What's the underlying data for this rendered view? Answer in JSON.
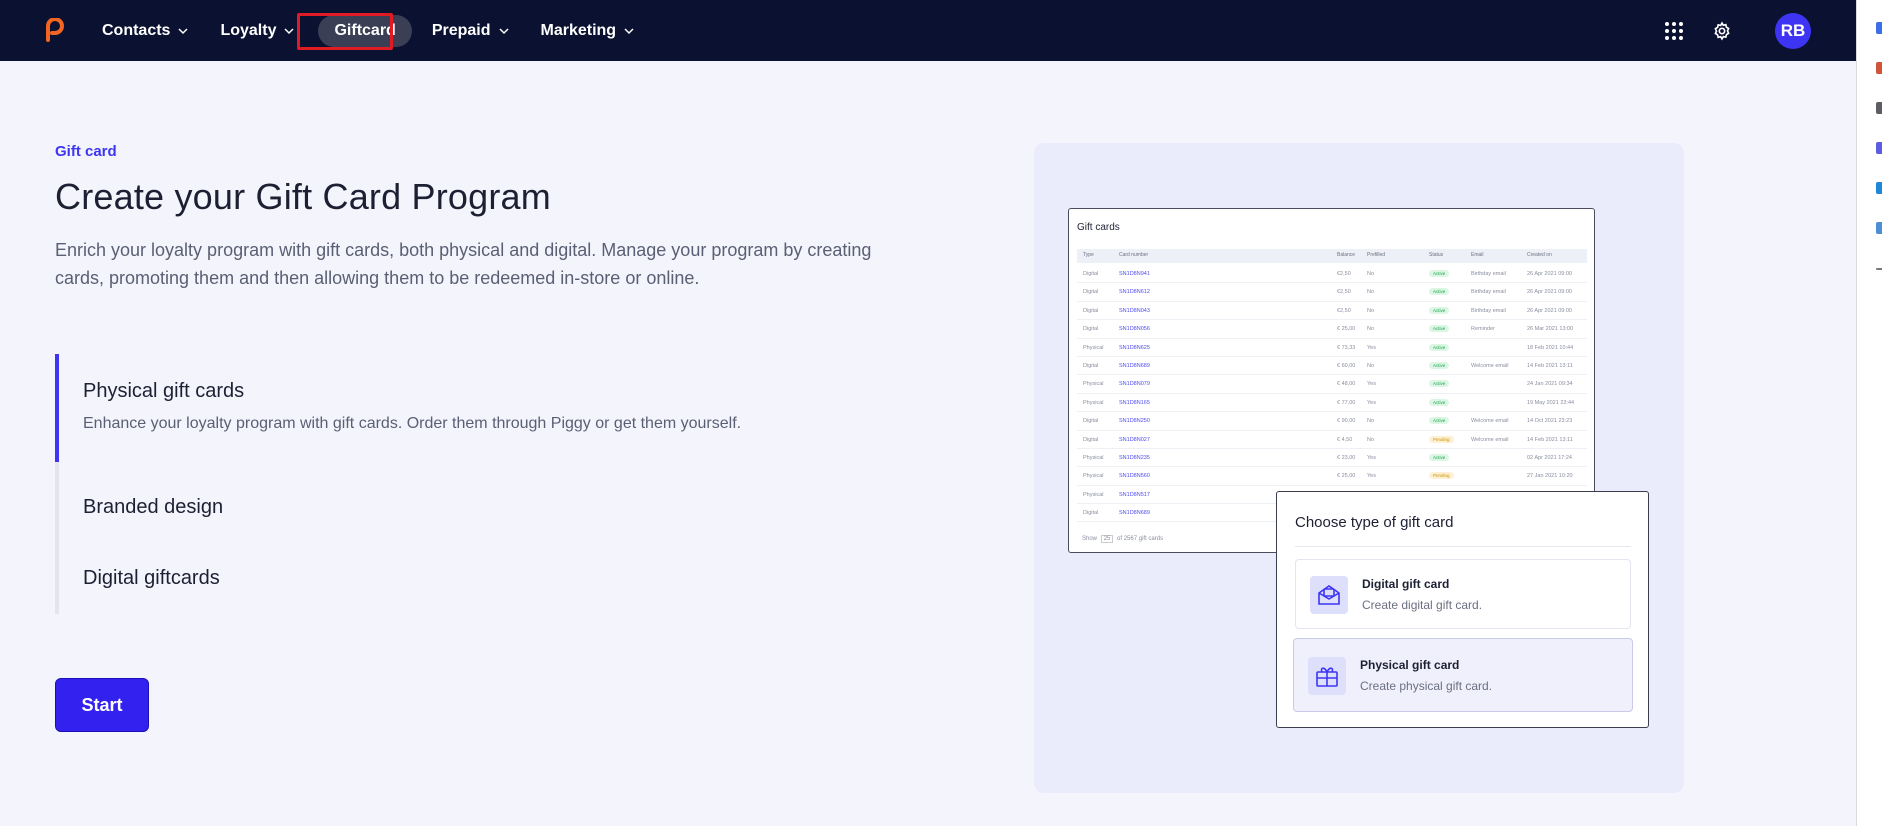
{
  "nav": {
    "items": [
      {
        "label": "Contacts",
        "has_dropdown": true
      },
      {
        "label": "Loyalty",
        "has_dropdown": true
      },
      {
        "label": "Giftcard",
        "has_dropdown": false,
        "active": true
      },
      {
        "label": "Prepaid",
        "has_dropdown": true
      },
      {
        "label": "Marketing",
        "has_dropdown": true
      }
    ],
    "logo_icon": "piggy-logo-icon",
    "apps_icon": "grid-icon",
    "settings_icon": "gear-icon",
    "avatar_initials": "RB"
  },
  "hero": {
    "eyebrow": "Gift card",
    "title": "Create your Gift Card Program",
    "subtitle": "Enrich your loyalty program with gift cards, both physical and digital. Manage your program by creating cards, promoting them and then allowing them to be redeemed in-store or online."
  },
  "features": [
    {
      "title": "Physical gift cards",
      "description": "Enhance your loyalty program with gift cards. Order them through Piggy or get them yourself.",
      "active": true
    },
    {
      "title": "Branded design",
      "active": false
    },
    {
      "title": "Digital giftcards",
      "active": false
    }
  ],
  "start_label": "Start",
  "illustration": {
    "table_title": "Gift cards",
    "columns": [
      "Type",
      "Card number",
      "Balance",
      "Prefilled",
      "Status",
      "Email",
      "Created on"
    ],
    "rows": [
      [
        "Digital",
        "SN1D8N941",
        "€2,50",
        "No",
        "Active",
        "Birthday email",
        "26 Apr 2021 09:00"
      ],
      [
        "Digital",
        "SN1D8N612",
        "€2,50",
        "No",
        "Active",
        "Birthday email",
        "26 Apr 2021 09:00"
      ],
      [
        "Digital",
        "SN1D8N043",
        "€2,50",
        "No",
        "Active",
        "Birthday email",
        "26 Apr 2021 09:00"
      ],
      [
        "Digital",
        "SN1D8N056",
        "€ 25,00",
        "No",
        "Active",
        "Reminder",
        "26 Mar 2021 13:00"
      ],
      [
        "Physical",
        "SN1D8N625",
        "€ 73,33",
        "Yes",
        "Active",
        "",
        "18 Feb 2021 10:44"
      ],
      [
        "Digital",
        "SN1D8N689",
        "€ 60,00",
        "No",
        "Active",
        "Welcome email",
        "14 Feb 2021 13:11"
      ],
      [
        "Physical",
        "SN1D8N079",
        "€ 48,00",
        "Yes",
        "Active",
        "",
        "24 Jan 2021 09:34"
      ],
      [
        "Physical",
        "SN1D8N165",
        "€ 77,00",
        "Yes",
        "Active",
        "",
        "19 May 2021 23:44"
      ],
      [
        "Digital",
        "SN1D8N250",
        "€ 90,00",
        "No",
        "Active",
        "Welcome email",
        "14 Oct 2021 23:23"
      ],
      [
        "Digital",
        "SN1D8N027",
        "€ 4,50",
        "No",
        "Pending",
        "Welcome email",
        "14 Feb 2021 13:11"
      ],
      [
        "Physical",
        "SN1D8N235",
        "€ 23,00",
        "Yes",
        "Active",
        "",
        "02 Apr 2021 17:24"
      ],
      [
        "Physical",
        "SN1D8N560",
        "€ 25,00",
        "Yes",
        "Pending",
        "",
        "27 Jan 2021 10:20"
      ],
      [
        "Physical",
        "SN1D8N517",
        "",
        "",
        "",
        "",
        ""
      ],
      [
        "Digital",
        "SN1D8N689",
        "",
        "",
        "",
        "",
        ""
      ]
    ],
    "footer_show": "Show",
    "footer_count": "25",
    "footer_total": "of 2567 gift cards",
    "chooser_title": "Choose type of gift card",
    "options": [
      {
        "title": "Digital gift card",
        "description": "Create digital gift card.",
        "icon": "envelope-card-icon"
      },
      {
        "title": "Physical gift card",
        "description": "Create physical gift card.",
        "icon": "gift-box-icon"
      }
    ]
  },
  "colors": {
    "nav_bg": "#0b1130",
    "accent": "#3d35f3",
    "button": "#3321f0",
    "page_bg": "#f3f4fc",
    "highlight_outline": "#e01b24"
  }
}
